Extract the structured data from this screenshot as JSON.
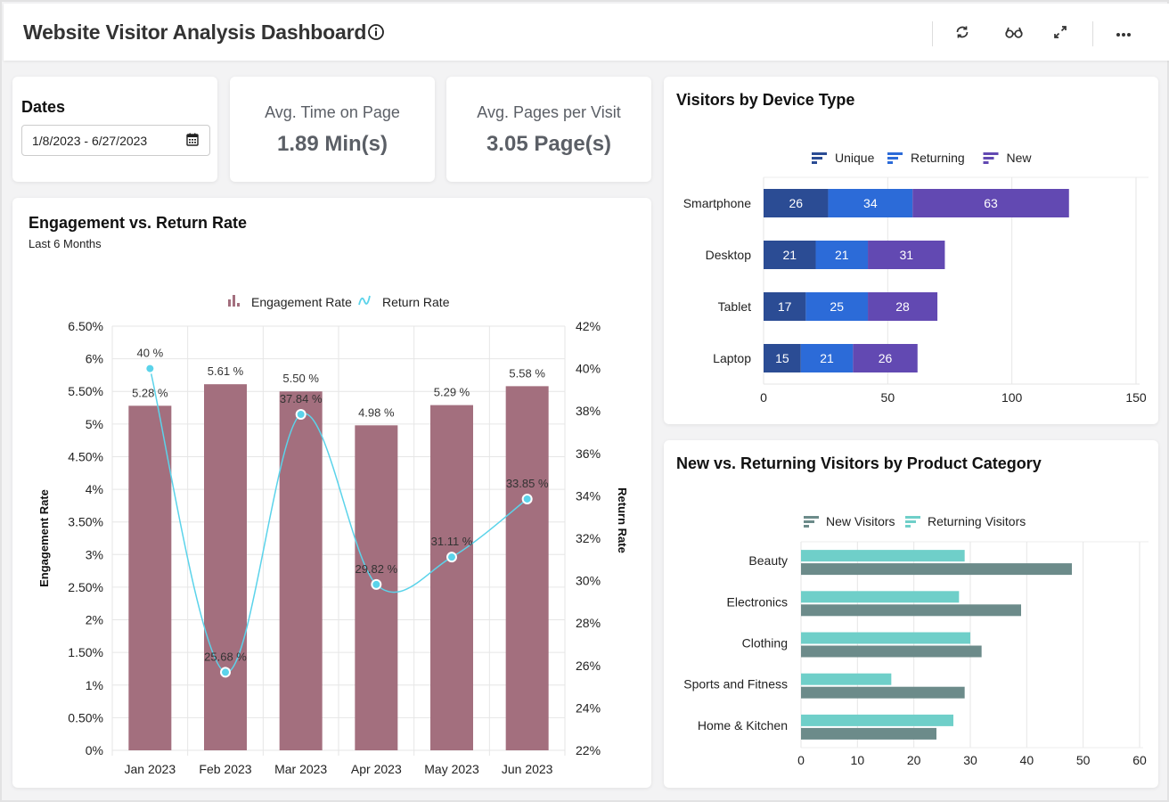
{
  "header": {
    "title": "Website Visitor Analysis Dashboard",
    "icons": [
      "info-icon",
      "refresh-icon",
      "glasses-icon",
      "expand-icon",
      "more-icon"
    ]
  },
  "dates": {
    "label": "Dates",
    "value": "1/8/2023 - 6/27/2023",
    "icon": "calendar-icon"
  },
  "kpis": [
    {
      "label": "Avg. Time on Page",
      "value": "1.89 Min(s)"
    },
    {
      "label": "Avg. Pages per Visit",
      "value": "3.05 Page(s)"
    }
  ],
  "engagement": {
    "title": "Engagement vs. Return Rate",
    "subtitle": "Last 6 Months"
  },
  "device": {
    "title": "Visitors by Device Type"
  },
  "category": {
    "title": "New vs. Returning Visitors by Product Category"
  },
  "colors": {
    "bar_engagement": "#a36f7e",
    "line_return": "#5bd3ea",
    "unique": "#2b4c94",
    "returning": "#2c6bd8",
    "new": "#6249b2",
    "new_visitors": "#6c8b8a",
    "returning_visitors": "#6fcfc9"
  },
  "chart_data": [
    {
      "type": "bar+line",
      "title": "Engagement vs. Return Rate",
      "subtitle": "Last 6 Months",
      "categories": [
        "Jan 2023",
        "Feb 2023",
        "Mar 2023",
        "Apr 2023",
        "May 2023",
        "Jun 2023"
      ],
      "series": [
        {
          "name": "Engagement Rate",
          "type": "bar",
          "axis": "left",
          "values": [
            5.28,
            5.61,
            5.5,
            4.98,
            5.29,
            5.58
          ],
          "labels": [
            "5.28 %",
            "5.61 %",
            "5.50 %",
            "4.98 %",
            "5.29 %",
            "5.58 %"
          ]
        },
        {
          "name": "Return Rate",
          "type": "line",
          "axis": "right",
          "values": [
            40,
            25.68,
            37.84,
            29.82,
            31.11,
            33.85
          ],
          "labels": [
            "40 %",
            "25.68 %",
            "37.84 %",
            "29.82 %",
            "31.11 %",
            "33.85 %"
          ]
        }
      ],
      "ylabel": "Engagement Rate",
      "ylabel_right": "Return Rate",
      "ylim": [
        0,
        6.5
      ],
      "yticks": [
        "0%",
        "0.50%",
        "1%",
        "1.50%",
        "2%",
        "2.50%",
        "3%",
        "3.50%",
        "4%",
        "4.50%",
        "5%",
        "5.50%",
        "6%",
        "6.50%"
      ],
      "ylim_right": [
        22,
        42
      ],
      "yticks_right": [
        "22%",
        "24%",
        "26%",
        "28%",
        "30%",
        "32%",
        "34%",
        "36%",
        "38%",
        "40%",
        "42%"
      ],
      "legend": [
        "Engagement Rate",
        "Return Rate"
      ],
      "legend_position": "top-center",
      "grid": true
    },
    {
      "type": "bar",
      "orientation": "horizontal-stacked",
      "title": "Visitors by Device Type",
      "categories": [
        "Smartphone",
        "Desktop",
        "Tablet",
        "Laptop"
      ],
      "series": [
        {
          "name": "Unique",
          "values": [
            26,
            21,
            17,
            15
          ]
        },
        {
          "name": "Returning",
          "values": [
            34,
            21,
            25,
            21
          ]
        },
        {
          "name": "New",
          "values": [
            63,
            31,
            28,
            26
          ]
        }
      ],
      "xlim": [
        0,
        150
      ],
      "xticks": [
        "0",
        "50",
        "100",
        "150"
      ],
      "legend_position": "top-center",
      "grid": true
    },
    {
      "type": "bar",
      "orientation": "horizontal-grouped",
      "title": "New vs. Returning Visitors by Product Category",
      "categories": [
        "Beauty",
        "Electronics",
        "Clothing",
        "Sports and Fitness",
        "Home & Kitchen"
      ],
      "series": [
        {
          "name": "New Visitors",
          "values": [
            48,
            39,
            32,
            29,
            24
          ]
        },
        {
          "name": "Returning Visitors",
          "values": [
            29,
            28,
            30,
            16,
            27
          ]
        }
      ],
      "xlim": [
        0,
        60
      ],
      "xticks": [
        "0",
        "10",
        "20",
        "30",
        "40",
        "50",
        "60"
      ],
      "legend_position": "top-center",
      "grid": true
    }
  ]
}
